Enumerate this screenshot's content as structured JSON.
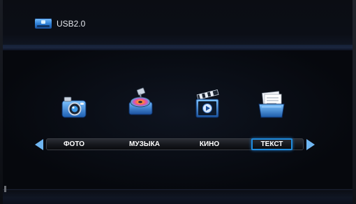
{
  "header": {
    "device_label": "USB2.0",
    "device_icon": "usb-drive-icon"
  },
  "menu": {
    "items": [
      {
        "label": "ФОТО",
        "icon": "photo-camera-icon"
      },
      {
        "label": "МУЗЫКА",
        "icon": "music-projector-icon"
      },
      {
        "label": "КИНО",
        "icon": "movie-clapper-icon"
      },
      {
        "label": "ТЕКСТ",
        "icon": "text-folder-icon"
      }
    ],
    "selected_index": 3
  },
  "colors": {
    "accent": "#1f8bdc",
    "arrow": "#6fb6f2",
    "text": "#ffffff"
  }
}
